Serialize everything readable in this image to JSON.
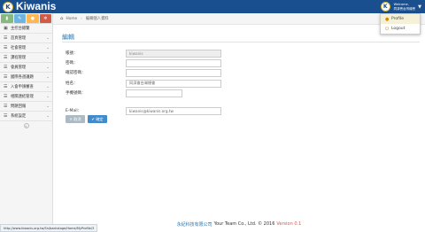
{
  "header": {
    "brand": "Kiwanis",
    "welcome": "Welcome,",
    "username": "同濟會台灣總會"
  },
  "user_menu": {
    "items": [
      {
        "label": "Profile",
        "icon": "user-icon"
      },
      {
        "label": "Logout",
        "icon": "power-icon"
      }
    ]
  },
  "sidebar": {
    "shortcuts": [
      {
        "icon": "signal-icon",
        "color": "#87b87f"
      },
      {
        "icon": "pencil-icon",
        "color": "#6fb3e0"
      },
      {
        "icon": "users-icon",
        "color": "#ffb752"
      },
      {
        "icon": "cogs-icon",
        "color": "#d15b47"
      }
    ],
    "items": [
      {
        "label": "主控台總覽"
      },
      {
        "label": "首頁管理"
      },
      {
        "label": "社會管理"
      },
      {
        "label": "課程管理"
      },
      {
        "label": "會員管理"
      },
      {
        "label": "國際各週議題"
      },
      {
        "label": "入會申請審查"
      },
      {
        "label": "相關連結管理"
      },
      {
        "label": "問題回報"
      },
      {
        "label": "系統設定"
      }
    ]
  },
  "breadcrumb": {
    "home": "Home",
    "current": "編輯個人資料"
  },
  "form": {
    "title": "編輯",
    "account_label": "帳號：",
    "account_value": "kiwanis",
    "password_label": "密碼：",
    "confirm_label": "確認密碼：",
    "name_label": "姓名：",
    "name_value": "同濟會台灣總會",
    "phone_label": "手機號碼：",
    "email_label": "E-Mail：",
    "email_value": "kiwanis@kiwanis.org.tw",
    "cancel_label": "✕ 取消",
    "save_label": "✔ 確定"
  },
  "footer": {
    "company": "永紀科技有限公司",
    "text": "Your Team Co., Ltd. © 2016",
    "version": "Version 0.1"
  },
  "status_url": "http://www.kiwanis.org.tw/Sn/backstage/Home/MyProfile/3"
}
